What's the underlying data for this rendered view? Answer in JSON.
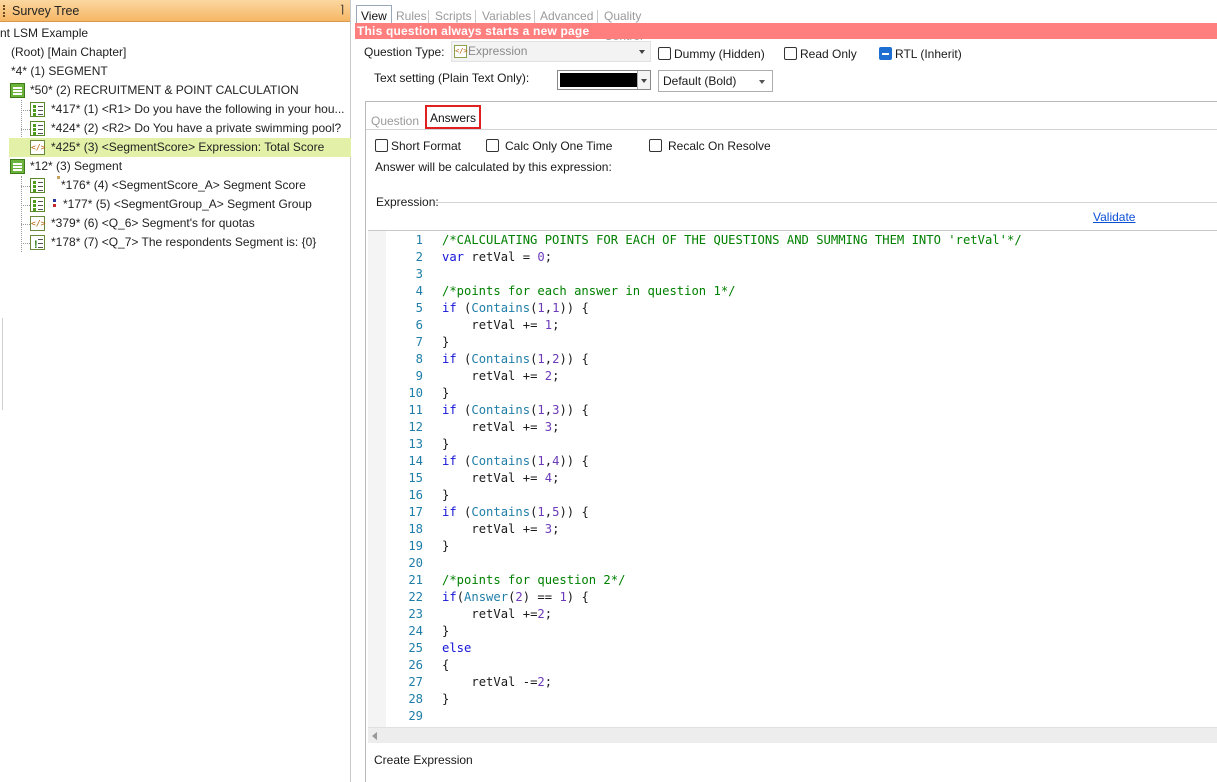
{
  "survey_tree": {
    "title": "Survey Tree",
    "pin_glyph": "⌉",
    "nodes": [
      {
        "label": "nt LSM Example",
        "icon": "none"
      },
      {
        "label": "(Root) [Main Chapter]",
        "icon": "none"
      },
      {
        "label": "*4* (1) SEGMENT",
        "icon": "none"
      },
      {
        "label": "*50* (2) RECRUITMENT & POINT CALCULATION",
        "icon": "chapter-icon"
      },
      {
        "label": "*417* (1) <R1> Do you have the following in your hou...",
        "icon": "list-question-icon"
      },
      {
        "label": "*424* (2) <R2> Do You have a private swimming pool?",
        "icon": "list-question-icon"
      },
      {
        "label": "*425* (3) <SegmentScore> Expression: Total Score",
        "icon": "expression-icon",
        "selected": true
      },
      {
        "label": "*12* (3) Segment",
        "icon": "chapter-icon"
      },
      {
        "label": "*176* (4) <SegmentScore_A> Segment Score",
        "icon": "list-question-icon"
      },
      {
        "label": "*177* (5) <SegmentGroup_A> Segment Group",
        "icon": "list-question-icon"
      },
      {
        "label": "*379* (6) <Q_6> Segment's for quotas",
        "icon": "expression-icon"
      },
      {
        "label": "*178* (7) <Q_7> The respondents Segment is: {0}",
        "icon": "text-question-icon"
      }
    ]
  },
  "top_tabs": [
    "View",
    "Rules",
    "Scripts",
    "Variables",
    "Advanced",
    "Quality Control"
  ],
  "banner": "This question always starts a new page",
  "question_type": {
    "label": "Question Type:",
    "value": "Expression",
    "icon_glyph": "</>"
  },
  "flags": {
    "dummy": {
      "label": "Dummy (Hidden)",
      "checked": false
    },
    "read_only": {
      "label": "Read Only",
      "checked": false
    },
    "rtl": {
      "label": "RTL (Inherit)",
      "checked": "indeterminate"
    }
  },
  "text_setting": {
    "label": "Text setting (Plain Text Only):",
    "color": "#000000",
    "font_style": "Default (Bold)"
  },
  "inner_tabs": [
    "Question",
    "Answers"
  ],
  "answers": {
    "short_format": "Short Format",
    "calc_only_one_time": "Calc Only One Time",
    "recalc_on_resolve": "Recalc On Resolve",
    "hint": "Answer will be calculated by this expression:",
    "expression_label": "Expression:",
    "validate_link": "Validate",
    "create_expression": "Create Expression"
  },
  "code_lines": [
    "/*CALCULATING POINTS FOR EACH OF THE QUESTIONS AND SUMMING THEM INTO 'retVal'*/",
    "var retVal = 0;",
    "",
    "/*points for each answer in question 1*/",
    "if (Contains(1,1)) {",
    "    retVal += 1;",
    "}",
    "if (Contains(1,2)) {",
    "    retVal += 2;",
    "}",
    "if (Contains(1,3)) {",
    "    retVal += 3;",
    "}",
    "if (Contains(1,4)) {",
    "    retVal += 4;",
    "}",
    "if (Contains(1,5)) {",
    "    retVal += 3;",
    "}",
    "",
    "/*points for question 2*/",
    "if(Answer(2) == 1) {",
    "    retVal +=2;",
    "}",
    "else",
    "{",
    "    retVal -=2;",
    "}",
    ""
  ],
  "colors": {
    "tree_header": "#f6b765",
    "selected_row": "#e3f1a8",
    "banner": "#ff7f7f",
    "active_tab_outline": "#e02020",
    "comment": "#008000",
    "keyword": "#1414d8",
    "function": "#1f7ea8",
    "number": "#6c3ab8",
    "link": "#0b4fd6"
  }
}
